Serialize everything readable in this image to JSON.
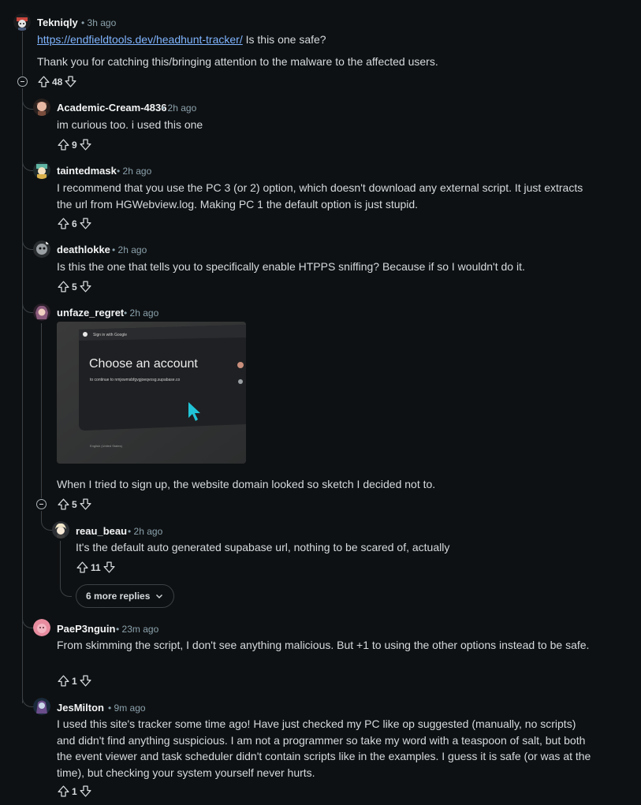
{
  "comments": [
    {
      "username": "Tekniqly",
      "time": "3h ago",
      "link_text": "https://endfieldtools.dev/headhunt-tracker/",
      "text_after_link": "Is this one safe?",
      "paragraph2": "Thank you for catching this/bringing attention to the malware to the affected users.",
      "votes": "48",
      "avatar_color": "#c9463d"
    },
    {
      "username": "Academic-Cream-4836",
      "time": "2h ago",
      "text": "im curious too. i used this one",
      "votes": "9",
      "avatar_color": "#e8b9a4"
    },
    {
      "username": "taintedmask",
      "time": "2h ago",
      "text": "I recommend that you use the PC 3 (or 2) option, which doesn't download any external script. It just extracts the url from HGWebview.log. Making PC 1 the default option is just stupid.",
      "votes": "6",
      "avatar_color": "#5fb4a2"
    },
    {
      "username": "deathlokke",
      "time": "2h ago",
      "text": "Is this the one that tells you to specifically enable HTPPS sniffing? Because if so I wouldn't do it.",
      "votes": "5",
      "avatar_color": "#9aa0a4"
    },
    {
      "username": "unfaze_regret",
      "time": "2h ago",
      "text": "When I tried to sign up, the website domain looked so sketch I decided not to.",
      "votes": "5",
      "avatar_color": "#8a5a7c",
      "image": {
        "dialog_header": "Sign in with Google",
        "title": "Choose an account",
        "subtitle": "to continue to nmjxwmsbfgvgjoeqvosg.supabase.co",
        "footer": "English (United States)"
      }
    },
    {
      "username": "reau_beau",
      "time": "2h ago",
      "text": "It's the default auto generated supabase url, nothing to be scared of, actually",
      "votes": "11",
      "avatar_color": "#f0e6c8"
    },
    {
      "username": "PaeP3nguin",
      "time": "23m ago",
      "text": "From skimming the script, I don't see anything malicious. But +1 to using the other options instead to be safe.",
      "votes": "1",
      "avatar_color": "#e88ca0"
    },
    {
      "username": "JesMilton",
      "time": "9m ago",
      "text": "I used this site's tracker some time ago! Have just checked my PC like op suggested (manually, no scripts) and didn't find anything suspicious. I am not a programmer so take my word with a teaspoon of salt, but both the event viewer and task scheduler didn't contain scripts like in the examples. I guess it is safe (or was at the time), but checking your system yourself never hurts.",
      "votes": "1",
      "avatar_color": "#6a4d8a"
    }
  ],
  "more_replies_label": "6 more replies",
  "separator": "•",
  "icons": {
    "upvote": "arrow-up-outline-icon",
    "downvote": "arrow-down-outline-icon",
    "collapse": "minus-circle-icon",
    "chevron": "chevron-down-icon"
  }
}
